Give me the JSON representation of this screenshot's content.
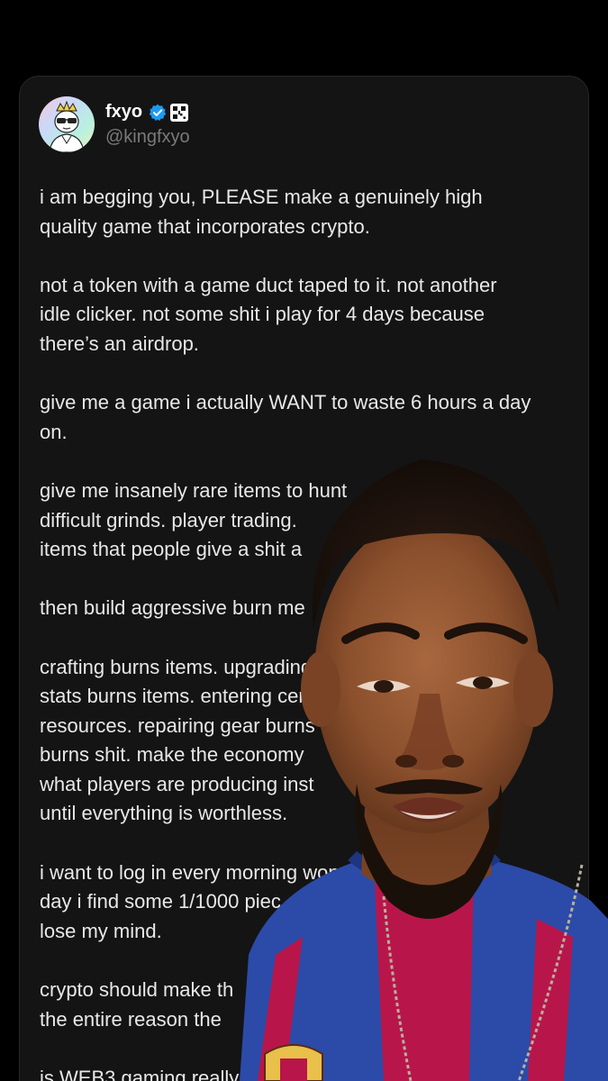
{
  "author": {
    "display_name": "fxyo",
    "handle": "@kingfxyo",
    "verified_color": "#1d9bf0"
  },
  "tweet": {
    "paragraphs": [
      "i am begging you, PLEASE make a genuinely high\nquality game that incorporates crypto.",
      "not a token with a game duct taped to it. not another\nidle clicker. not some shit i play for 4 days because\nthere’s an airdrop.",
      "give me a game i actually WANT to waste 6 hours a day\non.",
      "give me insanely rare items to hunt\ndifficult grinds. player trading.\nitems that people give a shit a",
      "then build aggressive burn me",
      "crafting burns items. upgrading\nstats burns items. entering cer\nresources. repairing gear burns\nburns shit. make the economy\nwhat players are producing inst\nuntil everything is worthless.",
      "i want to log in every morning wonde\nday i find some 1/1000 piec\nlose my mind.",
      "crypto should make th\nthe entire reason the",
      "is WEB3 gaming really"
    ]
  },
  "overlay": {
    "subject": "person-webcam-overlay",
    "shirt_colors": [
      "#2c4aa8",
      "#b8164a"
    ]
  }
}
